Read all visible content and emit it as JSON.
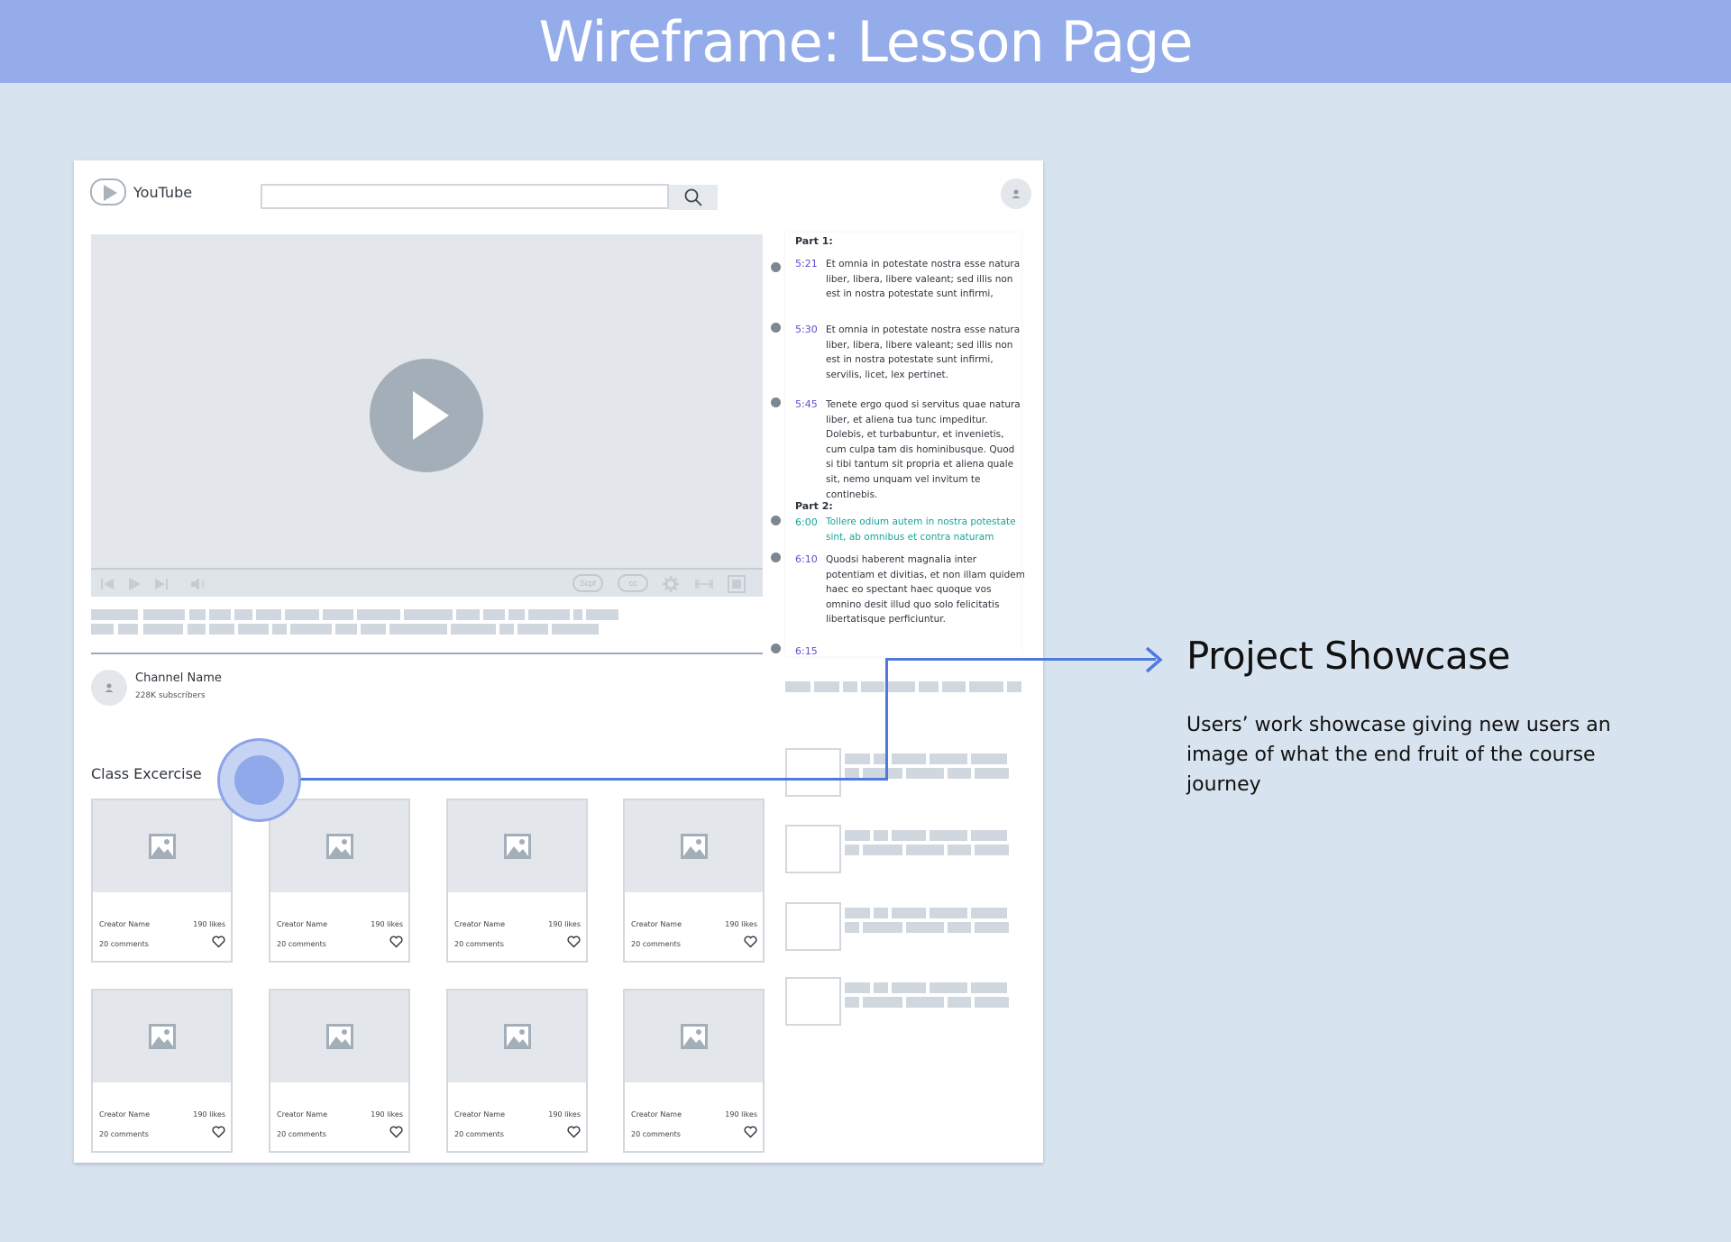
{
  "banner": {
    "title": "Wireframe: Lesson Page"
  },
  "header": {
    "logo_text": "YouTube"
  },
  "player": {
    "pill_script": "Scpt",
    "pill_cc": "cc"
  },
  "channel": {
    "name": "Channel Name",
    "subscribers": "228K subscribers"
  },
  "class_exercise": {
    "title": "Class Excercise",
    "cards": [
      {
        "creator": "Creator Name",
        "likes": "190 likes",
        "comments": "20 comments"
      },
      {
        "creator": "Creator Name",
        "likes": "190 likes",
        "comments": "20 comments"
      },
      {
        "creator": "Creator Name",
        "likes": "190 likes",
        "comments": "20 comments"
      },
      {
        "creator": "Creator Name",
        "likes": "190 likes",
        "comments": "20 comments"
      },
      {
        "creator": "Creator Name",
        "likes": "190 likes",
        "comments": "20 comments"
      },
      {
        "creator": "Creator Name",
        "likes": "190 likes",
        "comments": "20 comments"
      },
      {
        "creator": "Creator Name",
        "likes": "190 likes",
        "comments": "20 comments"
      },
      {
        "creator": "Creator Name",
        "likes": "190 likes",
        "comments": "20 comments"
      }
    ]
  },
  "transcript": {
    "part1": "Part 1:",
    "part2": "Part 2:",
    "entries": [
      {
        "time": "5:21",
        "text": "Et omnia in potestate nostra esse natura\nliber, libera, libere valeant; sed illis non\nest in nostra potestate sunt infirmi,"
      },
      {
        "time": "5:30",
        "text": "Et omnia in potestate nostra esse natura\nliber, libera, libere valeant; sed illis non\nest in nostra potestate sunt infirmi,\nservilis, licet, lex pertinet."
      },
      {
        "time": "5:45",
        "text": "Tenete ergo quod si servitus quae natura\nliber, et aliena tua tunc impeditur.\nDolebis, et turbabuntur, et invenietis,\ncum culpa tam dis hominibusque. Quod\nsi tibi tantum sit propria et aliena quale\nsit, nemo unquam vel invitum te\ncontinebis."
      },
      {
        "time": "6:00",
        "text": "Tollere odium autem in nostra potestate\nsint, ab omnibus et contra naturam"
      },
      {
        "time": "6:10",
        "text": "Quodsi haberent magnalia inter\npotentiam et divitias, et non illam quidem\nhaec eo spectant haec quoque vos\nomnino desit illud quo solo felicitatis\nlibertatisque perficiuntur."
      },
      {
        "time": "6:15",
        "text": ""
      }
    ]
  },
  "callout": {
    "title": "Project Showcase",
    "description": "Users’ work showcase giving new users an image of what the end fruit of the course journey"
  },
  "colors": {
    "banner": "#94ace9",
    "background": "#d7e3ef",
    "accent_blue": "#4e7ae0",
    "timestamp": "#5a4fd0",
    "active_text": "#17a39a"
  }
}
